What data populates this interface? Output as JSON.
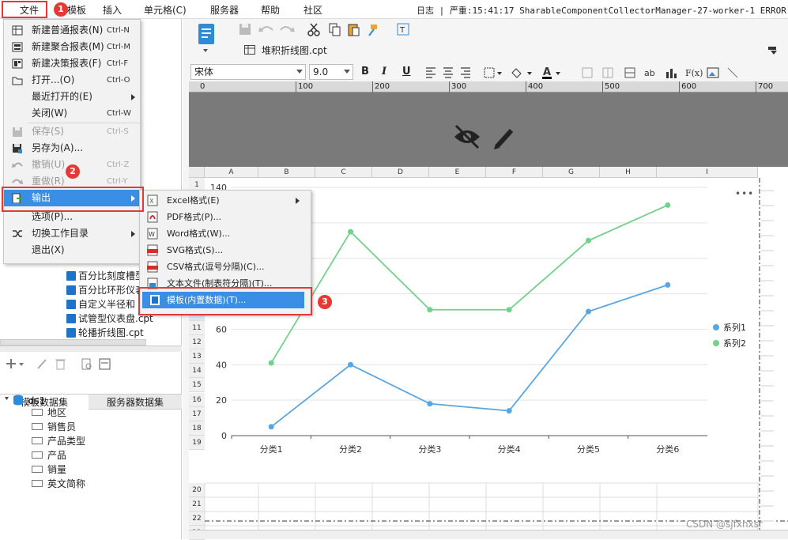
{
  "menubar": {
    "items": [
      "文件",
      "模板",
      "插入",
      "单元格(C)",
      "服务器",
      "帮助",
      "社区"
    ],
    "log": "日志 | 严重:15:41:17 SharableComponentCollectorManager-27-worker-1 ERROR [stan"
  },
  "file_menu": {
    "items": [
      {
        "label": "新建普通报表(N)",
        "shortcut": "Ctrl-N",
        "enabled": true,
        "icon": "new-report-icon"
      },
      {
        "label": "新建聚合报表(M)",
        "shortcut": "Ctrl-M",
        "enabled": true,
        "icon": "aggregate-report-icon"
      },
      {
        "label": "新建决策报表(F)",
        "shortcut": "Ctrl-F",
        "enabled": true,
        "icon": "dashboard-report-icon"
      },
      {
        "label": "打开...(O)",
        "shortcut": "Ctrl-O",
        "enabled": true,
        "icon": "folder-open-icon"
      },
      {
        "label": "最近打开的(E)",
        "shortcut": "",
        "enabled": true,
        "submenu": true
      },
      {
        "label": "关闭(W)",
        "shortcut": "Ctrl-W",
        "enabled": true
      },
      {
        "label": "保存(S)",
        "shortcut": "Ctrl-S",
        "enabled": false,
        "icon": "save-icon"
      },
      {
        "label": "另存为(A)...",
        "shortcut": "",
        "enabled": true,
        "icon": "save-as-icon"
      },
      {
        "label": "撤销(U)",
        "shortcut": "Ctrl-Z",
        "enabled": false,
        "icon": "undo-icon"
      },
      {
        "label": "重做(R)",
        "shortcut": "Ctrl-Y",
        "enabled": false,
        "icon": "redo-icon"
      },
      {
        "label": "输出",
        "shortcut": "",
        "enabled": true,
        "submenu": true,
        "active": true,
        "icon": "export-icon"
      },
      {
        "label": "选项(P)...",
        "shortcut": "",
        "enabled": true
      },
      {
        "label": "切换工作目录",
        "shortcut": "",
        "enabled": true,
        "submenu": true,
        "icon": "switch-icon"
      },
      {
        "label": "退出(X)",
        "shortcut": "",
        "enabled": true
      }
    ]
  },
  "export_submenu": {
    "items": [
      {
        "label": "Excel格式(E)",
        "submenu": true,
        "icon": "excel-icon"
      },
      {
        "label": "PDF格式(P)...",
        "icon": "pdf-icon"
      },
      {
        "label": "Word格式(W)...",
        "icon": "word-icon"
      },
      {
        "label": "SVG格式(S)...",
        "icon": "svg-icon"
      },
      {
        "label": "CSV格式(逗号分隔)(C)...",
        "icon": "csv-icon"
      },
      {
        "label": "文本文件(制表符分隔)(T)...",
        "icon": "text-icon"
      },
      {
        "label": "模板(内置数据)(T)...",
        "icon": "template-icon",
        "active": true
      }
    ]
  },
  "badges": [
    "1",
    "2",
    "3"
  ],
  "file_tree": [
    "百分比刻度槽型",
    "百分比环形仪表",
    "自定义半径和",
    "试管型仪表盘.cpt",
    "轮播折线图.cpt"
  ],
  "dataset_tabs": [
    "模板数据集",
    "服务器数据集"
  ],
  "dataset": {
    "name": "ds1",
    "fields": [
      "地区",
      "销售员",
      "产品类型",
      "产品",
      "销量",
      "英文简称"
    ]
  },
  "editor": {
    "tab_title": "堆积折线图.cpt",
    "font_name": "宋体",
    "font_size": "9.0",
    "ruler_ticks": [
      "0",
      "100",
      "200",
      "300",
      "400",
      "500",
      "600",
      "700"
    ],
    "columns": [
      "A",
      "B",
      "C",
      "D",
      "E",
      "F",
      "G",
      "H",
      "I"
    ],
    "rows_top": [
      "1",
      "2",
      "3",
      "4",
      "5",
      "6",
      "7",
      "8",
      "9",
      "10",
      "11",
      "12",
      "13",
      "14",
      "15",
      "16",
      "17",
      "18",
      "19"
    ],
    "rows_bottom": [
      "20",
      "21",
      "22",
      "23"
    ],
    "more_label": "•••"
  },
  "chart_data": {
    "type": "line",
    "categories": [
      "分类1",
      "分类2",
      "分类3",
      "分类4",
      "分类5",
      "分类6"
    ],
    "series": [
      {
        "name": "系列1",
        "color": "#5aa6e0",
        "values": [
          5,
          40,
          18,
          14,
          70,
          85
        ]
      },
      {
        "name": "系列2",
        "color": "#72d18a",
        "values": [
          41,
          115,
          71,
          71,
          110,
          130
        ]
      }
    ],
    "yticks": [
      "0",
      "20",
      "40",
      "60",
      "80",
      "100",
      "120",
      "140"
    ],
    "ylim": [
      0,
      140
    ],
    "legend": "right",
    "grid": true
  },
  "watermark": "CSDN @sjfxnxsr"
}
